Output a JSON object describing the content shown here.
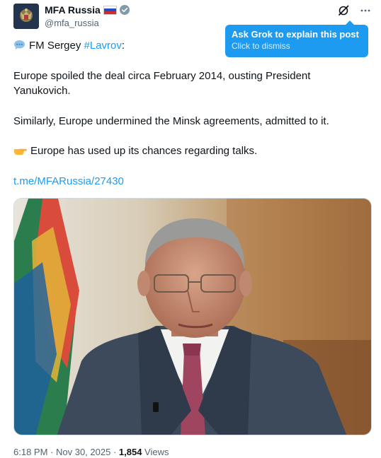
{
  "author": {
    "display_name": "MFA Russia",
    "handle": "@mfa_russia",
    "avatar_icon": "coat-of-arms-icon",
    "flag_icon": "russia-flag-icon",
    "verified_icon": "verified-badge-icon"
  },
  "tooltip": {
    "title": "Ask Grok to explain this post",
    "subtitle": "Click to dismiss"
  },
  "post": {
    "lead_prefix": "FM Sergey ",
    "hashtag": "#Lavrov",
    "lead_suffix": ":",
    "paragraph_1": "Europe spoiled the deal circa February 2014, ousting President Yanukovich.",
    "paragraph_2": "Similarly, Europe undermined the Minsk agreements, admitted to it.",
    "paragraph_3": "Europe has used up its chances regarding talks.",
    "link": "t.me/MFARussia/27430"
  },
  "meta": {
    "time": "6:18 PM",
    "separator": " · ",
    "date": "Nov 30, 2025",
    "views_count": "1,854",
    "views_label": " Views"
  },
  "colors": {
    "accent": "#1d9bf0",
    "text_primary": "#0f1419",
    "text_secondary": "#536471"
  }
}
